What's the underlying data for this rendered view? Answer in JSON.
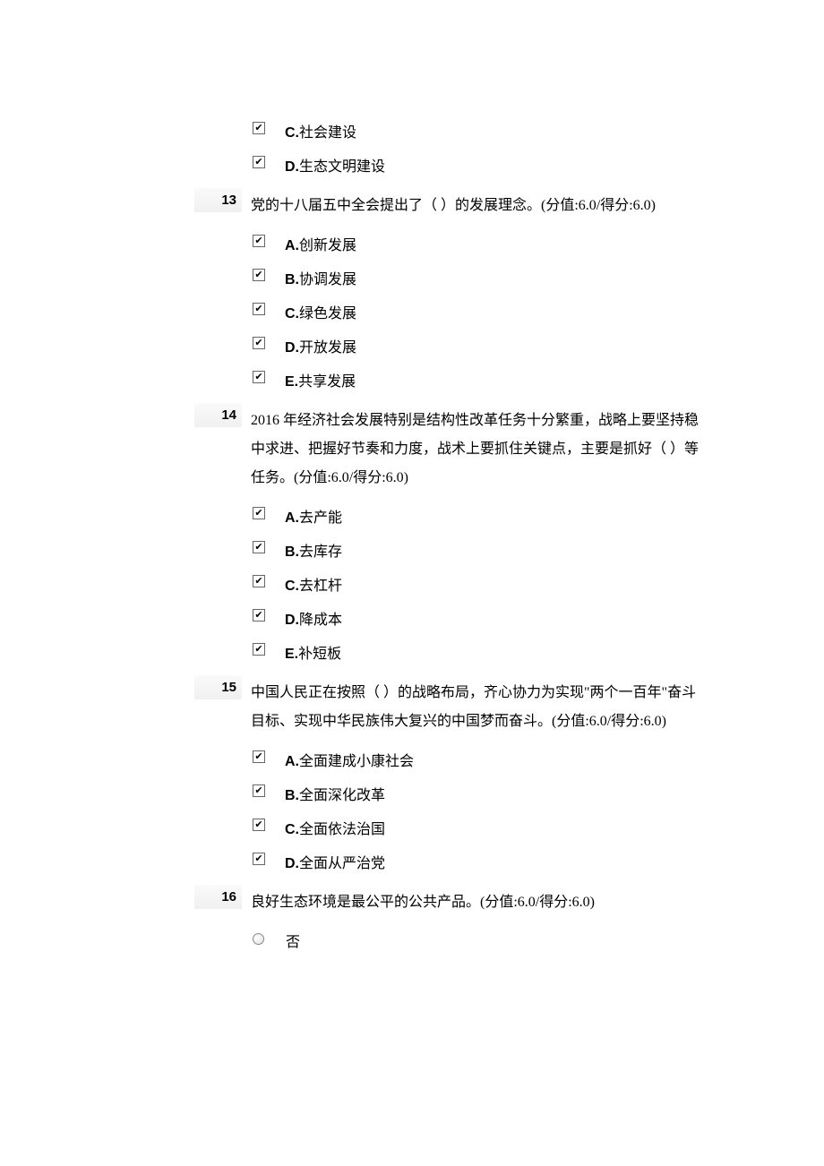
{
  "orphan_options": [
    {
      "letter": "C.",
      "text": "社会建设",
      "checked": true
    },
    {
      "letter": "D.",
      "text": "生态文明建设",
      "checked": true
    }
  ],
  "questions": [
    {
      "num": "13",
      "text": "党的十八届五中全会提出了（  ）的发展理念。(分值:6.0/得分:6.0)",
      "type": "checkbox",
      "options": [
        {
          "letter": "A.",
          "text": "创新发展",
          "checked": true
        },
        {
          "letter": "B.",
          "text": "协调发展",
          "checked": true
        },
        {
          "letter": "C.",
          "text": "绿色发展",
          "checked": true
        },
        {
          "letter": "D.",
          "text": "开放发展",
          "checked": true
        },
        {
          "letter": "E.",
          "text": "共享发展",
          "checked": true
        }
      ]
    },
    {
      "num": "14",
      "text": "2016 年经济社会发展特别是结构性改革任务十分繁重，战略上要坚持稳中求进、把握好节奏和力度，战术上要抓住关键点，主要是抓好（  ）等任务。(分值:6.0/得分:6.0)",
      "type": "checkbox",
      "options": [
        {
          "letter": "A.",
          "text": "去产能",
          "checked": true
        },
        {
          "letter": "B.",
          "text": "去库存",
          "checked": true
        },
        {
          "letter": "C.",
          "text": "去杠杆",
          "checked": true
        },
        {
          "letter": "D.",
          "text": "降成本",
          "checked": true
        },
        {
          "letter": "E.",
          "text": "补短板",
          "checked": true
        }
      ]
    },
    {
      "num": "15",
      "text": "中国人民正在按照（  ）的战略布局，齐心协力为实现\"两个一百年\"奋斗目标、实现中华民族伟大复兴的中国梦而奋斗。(分值:6.0/得分:6.0)",
      "type": "checkbox",
      "options": [
        {
          "letter": "A.",
          "text": "全面建成小康社会",
          "checked": true
        },
        {
          "letter": "B.",
          "text": "全面深化改革",
          "checked": true
        },
        {
          "letter": "C.",
          "text": "全面依法治国",
          "checked": true
        },
        {
          "letter": "D.",
          "text": "全面从严治党",
          "checked": true
        }
      ]
    },
    {
      "num": "16",
      "text": "良好生态环境是最公平的公共产品。(分值:6.0/得分:6.0)",
      "type": "radio",
      "options": [
        {
          "text": "否",
          "checked": false
        }
      ]
    }
  ]
}
